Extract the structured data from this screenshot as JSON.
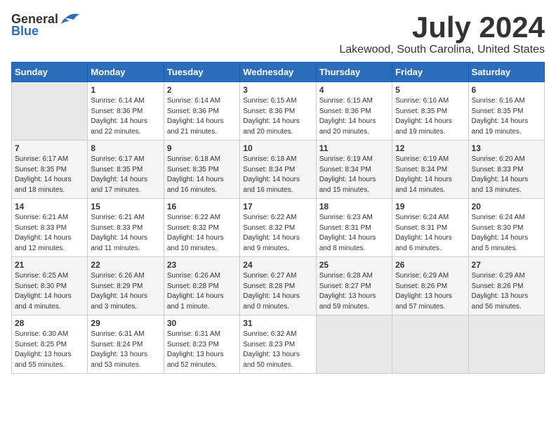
{
  "logo": {
    "general": "General",
    "blue": "Blue"
  },
  "title": "July 2024",
  "location": "Lakewood, South Carolina, United States",
  "days_of_week": [
    "Sunday",
    "Monday",
    "Tuesday",
    "Wednesday",
    "Thursday",
    "Friday",
    "Saturday"
  ],
  "weeks": [
    [
      {
        "day": "",
        "sunrise": "",
        "sunset": "",
        "daylight": "",
        "empty": true
      },
      {
        "day": "1",
        "sunrise": "Sunrise: 6:14 AM",
        "sunset": "Sunset: 8:36 PM",
        "daylight": "Daylight: 14 hours and 22 minutes.",
        "empty": false
      },
      {
        "day": "2",
        "sunrise": "Sunrise: 6:14 AM",
        "sunset": "Sunset: 8:36 PM",
        "daylight": "Daylight: 14 hours and 21 minutes.",
        "empty": false
      },
      {
        "day": "3",
        "sunrise": "Sunrise: 6:15 AM",
        "sunset": "Sunset: 8:36 PM",
        "daylight": "Daylight: 14 hours and 20 minutes.",
        "empty": false
      },
      {
        "day": "4",
        "sunrise": "Sunrise: 6:15 AM",
        "sunset": "Sunset: 8:36 PM",
        "daylight": "Daylight: 14 hours and 20 minutes.",
        "empty": false
      },
      {
        "day": "5",
        "sunrise": "Sunrise: 6:16 AM",
        "sunset": "Sunset: 8:35 PM",
        "daylight": "Daylight: 14 hours and 19 minutes.",
        "empty": false
      },
      {
        "day": "6",
        "sunrise": "Sunrise: 6:16 AM",
        "sunset": "Sunset: 8:35 PM",
        "daylight": "Daylight: 14 hours and 19 minutes.",
        "empty": false
      }
    ],
    [
      {
        "day": "7",
        "sunrise": "Sunrise: 6:17 AM",
        "sunset": "Sunset: 8:35 PM",
        "daylight": "Daylight: 14 hours and 18 minutes.",
        "empty": false
      },
      {
        "day": "8",
        "sunrise": "Sunrise: 6:17 AM",
        "sunset": "Sunset: 8:35 PM",
        "daylight": "Daylight: 14 hours and 17 minutes.",
        "empty": false
      },
      {
        "day": "9",
        "sunrise": "Sunrise: 6:18 AM",
        "sunset": "Sunset: 8:35 PM",
        "daylight": "Daylight: 14 hours and 16 minutes.",
        "empty": false
      },
      {
        "day": "10",
        "sunrise": "Sunrise: 6:18 AM",
        "sunset": "Sunset: 8:34 PM",
        "daylight": "Daylight: 14 hours and 16 minutes.",
        "empty": false
      },
      {
        "day": "11",
        "sunrise": "Sunrise: 6:19 AM",
        "sunset": "Sunset: 8:34 PM",
        "daylight": "Daylight: 14 hours and 15 minutes.",
        "empty": false
      },
      {
        "day": "12",
        "sunrise": "Sunrise: 6:19 AM",
        "sunset": "Sunset: 8:34 PM",
        "daylight": "Daylight: 14 hours and 14 minutes.",
        "empty": false
      },
      {
        "day": "13",
        "sunrise": "Sunrise: 6:20 AM",
        "sunset": "Sunset: 8:33 PM",
        "daylight": "Daylight: 14 hours and 13 minutes.",
        "empty": false
      }
    ],
    [
      {
        "day": "14",
        "sunrise": "Sunrise: 6:21 AM",
        "sunset": "Sunset: 8:33 PM",
        "daylight": "Daylight: 14 hours and 12 minutes.",
        "empty": false
      },
      {
        "day": "15",
        "sunrise": "Sunrise: 6:21 AM",
        "sunset": "Sunset: 8:33 PM",
        "daylight": "Daylight: 14 hours and 11 minutes.",
        "empty": false
      },
      {
        "day": "16",
        "sunrise": "Sunrise: 6:22 AM",
        "sunset": "Sunset: 8:32 PM",
        "daylight": "Daylight: 14 hours and 10 minutes.",
        "empty": false
      },
      {
        "day": "17",
        "sunrise": "Sunrise: 6:22 AM",
        "sunset": "Sunset: 8:32 PM",
        "daylight": "Daylight: 14 hours and 9 minutes.",
        "empty": false
      },
      {
        "day": "18",
        "sunrise": "Sunrise: 6:23 AM",
        "sunset": "Sunset: 8:31 PM",
        "daylight": "Daylight: 14 hours and 8 minutes.",
        "empty": false
      },
      {
        "day": "19",
        "sunrise": "Sunrise: 6:24 AM",
        "sunset": "Sunset: 8:31 PM",
        "daylight": "Daylight: 14 hours and 6 minutes.",
        "empty": false
      },
      {
        "day": "20",
        "sunrise": "Sunrise: 6:24 AM",
        "sunset": "Sunset: 8:30 PM",
        "daylight": "Daylight: 14 hours and 5 minutes.",
        "empty": false
      }
    ],
    [
      {
        "day": "21",
        "sunrise": "Sunrise: 6:25 AM",
        "sunset": "Sunset: 8:30 PM",
        "daylight": "Daylight: 14 hours and 4 minutes.",
        "empty": false
      },
      {
        "day": "22",
        "sunrise": "Sunrise: 6:26 AM",
        "sunset": "Sunset: 8:29 PM",
        "daylight": "Daylight: 14 hours and 3 minutes.",
        "empty": false
      },
      {
        "day": "23",
        "sunrise": "Sunrise: 6:26 AM",
        "sunset": "Sunset: 8:28 PM",
        "daylight": "Daylight: 14 hours and 1 minute.",
        "empty": false
      },
      {
        "day": "24",
        "sunrise": "Sunrise: 6:27 AM",
        "sunset": "Sunset: 8:28 PM",
        "daylight": "Daylight: 14 hours and 0 minutes.",
        "empty": false
      },
      {
        "day": "25",
        "sunrise": "Sunrise: 6:28 AM",
        "sunset": "Sunset: 8:27 PM",
        "daylight": "Daylight: 13 hours and 59 minutes.",
        "empty": false
      },
      {
        "day": "26",
        "sunrise": "Sunrise: 6:29 AM",
        "sunset": "Sunset: 8:26 PM",
        "daylight": "Daylight: 13 hours and 57 minutes.",
        "empty": false
      },
      {
        "day": "27",
        "sunrise": "Sunrise: 6:29 AM",
        "sunset": "Sunset: 8:26 PM",
        "daylight": "Daylight: 13 hours and 56 minutes.",
        "empty": false
      }
    ],
    [
      {
        "day": "28",
        "sunrise": "Sunrise: 6:30 AM",
        "sunset": "Sunset: 8:25 PM",
        "daylight": "Daylight: 13 hours and 55 minutes.",
        "empty": false
      },
      {
        "day": "29",
        "sunrise": "Sunrise: 6:31 AM",
        "sunset": "Sunset: 8:24 PM",
        "daylight": "Daylight: 13 hours and 53 minutes.",
        "empty": false
      },
      {
        "day": "30",
        "sunrise": "Sunrise: 6:31 AM",
        "sunset": "Sunset: 8:23 PM",
        "daylight": "Daylight: 13 hours and 52 minutes.",
        "empty": false
      },
      {
        "day": "31",
        "sunrise": "Sunrise: 6:32 AM",
        "sunset": "Sunset: 8:23 PM",
        "daylight": "Daylight: 13 hours and 50 minutes.",
        "empty": false
      },
      {
        "day": "",
        "sunrise": "",
        "sunset": "",
        "daylight": "",
        "empty": true
      },
      {
        "day": "",
        "sunrise": "",
        "sunset": "",
        "daylight": "",
        "empty": true
      },
      {
        "day": "",
        "sunrise": "",
        "sunset": "",
        "daylight": "",
        "empty": true
      }
    ]
  ]
}
